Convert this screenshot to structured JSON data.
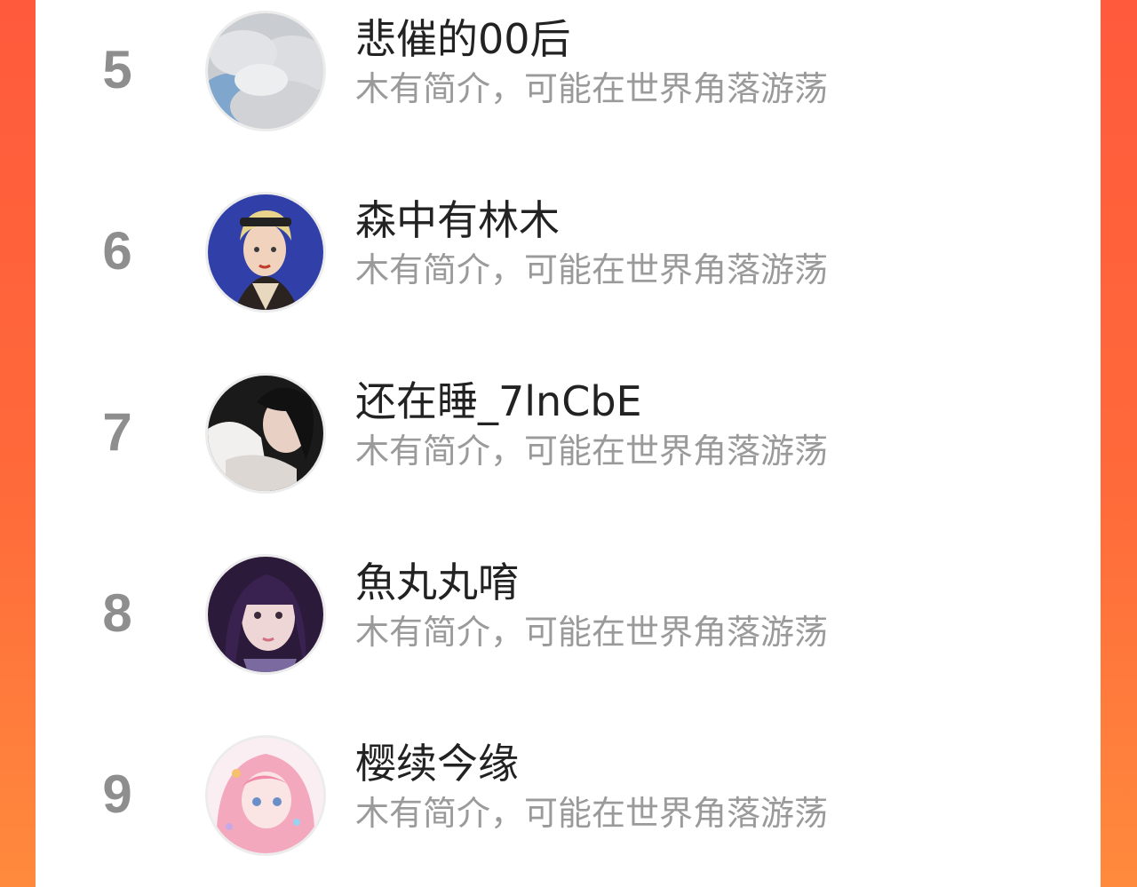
{
  "colors": {
    "accent_left": "#ff5a3c",
    "accent_right": "#ff8a3d",
    "rank_gray": "#8e8e8e",
    "name_text": "#222222",
    "desc_text": "#9a9a9a"
  },
  "ranking": [
    {
      "rank": "5",
      "name": "悲催的00后",
      "desc": "木有简介，可能在世界角落游荡",
      "avatar": "sky-clouds-avatar"
    },
    {
      "rank": "6",
      "name": "森中有林木",
      "desc": "木有简介，可能在世界角落游荡",
      "avatar": "illustrated-girl-avatar"
    },
    {
      "rank": "7",
      "name": "还在睡_7lnCbE",
      "desc": "木有简介，可能在世界角落游荡",
      "avatar": "dark-hair-girl-avatar"
    },
    {
      "rank": "8",
      "name": "魚丸丸唷",
      "desc": "木有简介，可能在世界角落游荡",
      "avatar": "purple-hair-girl-avatar"
    },
    {
      "rank": "9",
      "name": "樱续今缘",
      "desc": "木有简介，可能在世界角落游荡",
      "avatar": "pink-anime-girl-avatar"
    }
  ]
}
